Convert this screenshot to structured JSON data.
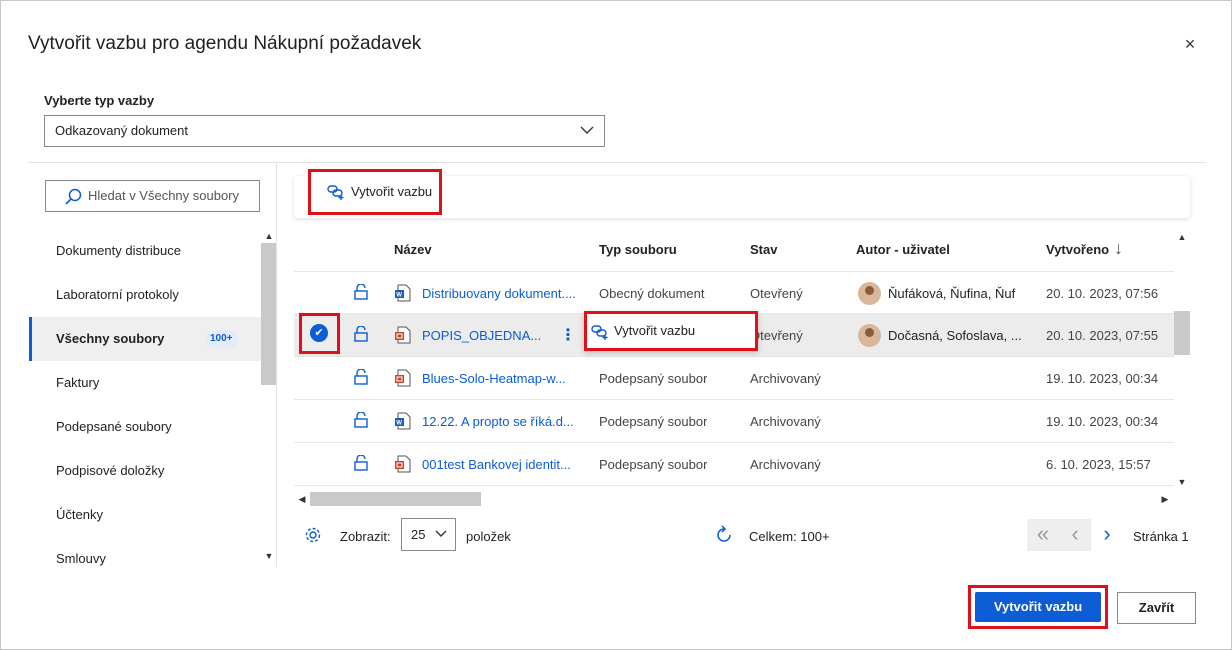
{
  "dialog": {
    "title": "Vytvořit vazbu pro agendu Nákupní požadavek",
    "close_symbol": "×"
  },
  "link_type": {
    "label": "Vyberte typ vazby",
    "selected": "Odkazovaný dokument"
  },
  "sidebar": {
    "search_placeholder": "Hledat v Všechny soubory",
    "items": [
      {
        "label": "Dokumenty distribuce"
      },
      {
        "label": "Laboratorní protokoly"
      },
      {
        "label": "Všechny soubory",
        "badge": "100+",
        "active": true
      },
      {
        "label": "Faktury"
      },
      {
        "label": "Podepsané soubory"
      },
      {
        "label": "Podpisové doložky"
      },
      {
        "label": "Účtenky"
      },
      {
        "label": "Smlouvy"
      }
    ]
  },
  "toolbar": {
    "create_link_label": "Vytvořit vazbu"
  },
  "table": {
    "columns": [
      "Název",
      "Typ souboru",
      "Stav",
      "Autor - uživatel",
      "Vytvořeno"
    ],
    "sort_indicator": "↓",
    "rows": [
      {
        "name": "Distribuovany dokument....",
        "type": "Obecný dokument",
        "status": "Otevřený",
        "author": "Ňufáková, Ňufina, Ňuf",
        "created": "20. 10. 2023, 07:56",
        "icon": "word-doc-icon"
      },
      {
        "name": "POPIS_OBJEDNA...",
        "type": "",
        "status": "Otevřený",
        "author": "Dočasná, Sofoslava, ...",
        "created": "20. 10. 2023, 07:55",
        "icon": "pdf-doc-icon",
        "selected": true
      },
      {
        "name": "Blues-Solo-Heatmap-w...",
        "type": "Podepsaný soubor",
        "status": "Archivovaný",
        "author": "",
        "created": "19. 10. 2023, 00:34",
        "icon": "pdf-doc-icon"
      },
      {
        "name": "12.22. A propto se říká.d...",
        "type": "Podepsaný soubor",
        "status": "Archivovaný",
        "author": "",
        "created": "19. 10. 2023, 00:34",
        "icon": "word-doc-icon"
      },
      {
        "name": "001test Bankovej identit...",
        "type": "Podepsaný soubor",
        "status": "Archivovaný",
        "author": "",
        "created": "6. 10. 2023, 15:57",
        "icon": "pdf-doc-icon"
      }
    ],
    "row_popup_label": "Vytvořit vazbu"
  },
  "pager": {
    "show_label": "Zobrazit:",
    "page_size": "25",
    "items_label": "položek",
    "total": "Celkem: 100+",
    "page": "Stránka 1"
  },
  "actions": {
    "primary": "Vytvořit vazbu",
    "secondary": "Zavřít"
  },
  "colors": {
    "accent": "#0b5cd5",
    "highlight": "#e0101a"
  }
}
